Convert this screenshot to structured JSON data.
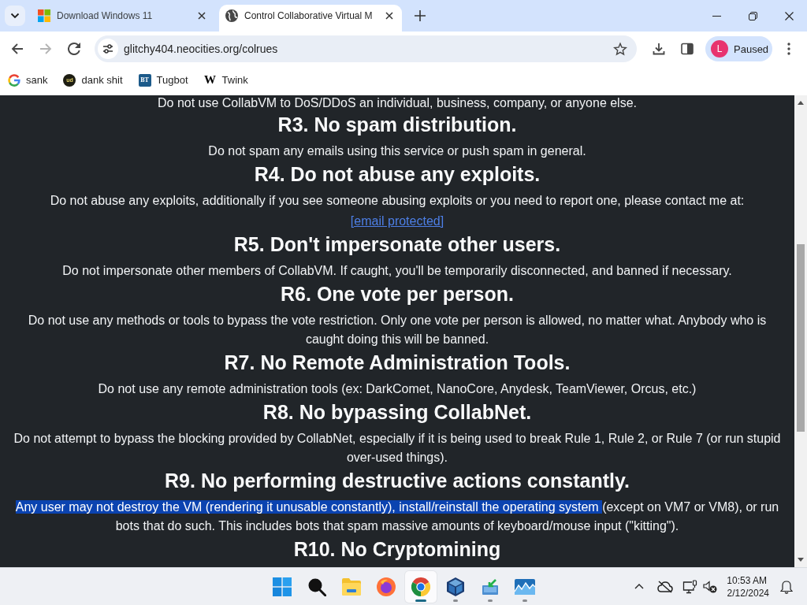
{
  "browser": {
    "tabs": [
      {
        "title": "Download Windows 11",
        "kind": "windows",
        "selected": false
      },
      {
        "title": "Control Collaborative Virtual M",
        "kind": "globe",
        "selected": true
      }
    ],
    "address": "glitchy404.neocities.org/colrues",
    "profile": {
      "initial": "L",
      "status": "Paused"
    },
    "bookmarks": [
      {
        "label": "sank",
        "kind": "google"
      },
      {
        "label": "dank shit",
        "kind": "badge",
        "icon_text": "ud"
      },
      {
        "label": "Tugbot",
        "kind": "tile",
        "icon_text": "BT"
      },
      {
        "label": "Twink",
        "kind": "letter",
        "icon_text": "W"
      }
    ]
  },
  "page": {
    "content": [
      {
        "kind": "paragraph",
        "lines": [
          [
            {
              "text": "Do not use CollabVM to DoS/DDoS an individual, business, company, or anyone else.",
              "selected": false
            }
          ]
        ]
      },
      {
        "kind": "heading",
        "text": "R3. No spam distribution."
      },
      {
        "kind": "paragraph",
        "lines": [
          [
            {
              "text": "Do not spam any emails using this service or push spam in general.",
              "selected": false
            }
          ]
        ]
      },
      {
        "kind": "heading",
        "text": "R4. Do not abuse any exploits."
      },
      {
        "kind": "paragraph",
        "lines": [
          [
            {
              "text": "Do not abuse any exploits, additionally if you see someone abusing exploits or you need to report one, please contact me at:",
              "selected": false
            }
          ]
        ]
      },
      {
        "kind": "link",
        "text": "[email protected]"
      },
      {
        "kind": "heading",
        "text": "R5. Don't impersonate other users."
      },
      {
        "kind": "paragraph",
        "lines": [
          [
            {
              "text": "Do not impersonate other members of CollabVM. If caught, you'll be temporarily disconnected, and banned if necessary.",
              "selected": false
            }
          ]
        ]
      },
      {
        "kind": "heading",
        "text": "R6. One vote per person."
      },
      {
        "kind": "paragraph",
        "lines": [
          [
            {
              "text": "Do not use any methods or tools to bypass the vote restriction. Only one vote per person is allowed, no matter what. Anybody who is",
              "selected": false
            }
          ],
          [
            {
              "text": "caught doing this will be banned.",
              "selected": false
            }
          ]
        ]
      },
      {
        "kind": "heading",
        "text": "R7. No Remote Administration Tools."
      },
      {
        "kind": "paragraph",
        "lines": [
          [
            {
              "text": "Do not use any remote administration tools (ex: DarkComet, NanoCore, Anydesk, TeamViewer, Orcus, etc.)",
              "selected": false
            }
          ]
        ]
      },
      {
        "kind": "heading",
        "text": "R8. No bypassing CollabNet."
      },
      {
        "kind": "paragraph",
        "lines": [
          [
            {
              "text": "Do not attempt to bypass the blocking provided by CollabNet, especially if it is being used to break Rule 1, Rule 2, or Rule 7 (or run stupid",
              "selected": false
            }
          ],
          [
            {
              "text": "over-used things).",
              "selected": false
            }
          ]
        ]
      },
      {
        "kind": "heading",
        "text": "R9. No performing destructive actions constantly."
      },
      {
        "kind": "paragraph",
        "lines": [
          [
            {
              "text": "Any user may not destroy the VM (rendering it unusable constantly), install/reinstall the operating system ",
              "selected": true
            },
            {
              "text": "(except on VM7 or VM8), or run",
              "selected": false
            }
          ],
          [
            {
              "text": "bots that do such. This includes bots that spam massive amounts of keyboard/mouse input (\"kitting\").",
              "selected": false
            }
          ]
        ]
      },
      {
        "kind": "heading",
        "text": "R10. No Cryptomining"
      }
    ]
  },
  "taskbar": {
    "apps": [
      {
        "kind": "start",
        "running": false,
        "active": false
      },
      {
        "kind": "search",
        "running": false,
        "active": false
      },
      {
        "kind": "folder",
        "running": false,
        "active": false
      },
      {
        "kind": "fox",
        "running": false,
        "active": false
      },
      {
        "kind": "chrome",
        "running": true,
        "active": true
      },
      {
        "kind": "cube",
        "running": true,
        "active": false
      },
      {
        "kind": "installer",
        "running": true,
        "active": false
      },
      {
        "kind": "monitor",
        "running": true,
        "active": false
      }
    ],
    "time": "10:53 AM",
    "date": "2/12/2024"
  }
}
